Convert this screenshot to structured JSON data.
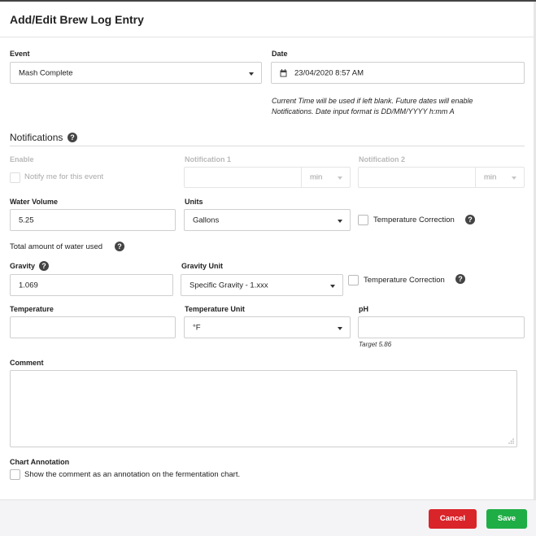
{
  "dialog": {
    "title": "Add/Edit Brew Log Entry"
  },
  "event": {
    "label": "Event",
    "value": "Mash Complete"
  },
  "date": {
    "label": "Date",
    "value": "23/04/2020 8:57 AM",
    "icon": "calendar-icon",
    "note": "Current Time will be used if left blank. Future dates will enable Notifications. Date input format is DD/MM/YYYY h:mm A"
  },
  "notifications": {
    "title": "Notifications",
    "enable_label": "Enable",
    "notify_label": "Notify me for this event",
    "notification1_label": "Notification 1",
    "notification1_value": "",
    "notification1_unit": "min",
    "notification2_label": "Notification 2",
    "notification2_value": "",
    "notification2_unit": "min"
  },
  "water": {
    "label": "Water Volume",
    "value": "5.25",
    "units_label": "Units",
    "units_value": "Gallons",
    "temp_correction_label": "Temperature Correction",
    "help_text": "Total amount of water used"
  },
  "gravity": {
    "label": "Gravity",
    "value": "1.069",
    "unit_label": "Gravity Unit",
    "unit_value": "Specific Gravity - 1.xxx",
    "temp_correction_label": "Temperature Correction"
  },
  "temperature": {
    "label": "Temperature",
    "value": "",
    "unit_label": "Temperature Unit",
    "unit_value": "°F"
  },
  "ph": {
    "label": "pH",
    "value": "",
    "target": "Target 5.86"
  },
  "comment": {
    "label": "Comment",
    "value": ""
  },
  "annotation": {
    "label": "Chart Annotation",
    "checkbox_label": "Show the comment as an annotation on the fermentation chart."
  },
  "footer": {
    "cancel_label": "Cancel",
    "save_label": "Save"
  },
  "colors": {
    "cancel": "#d9242a",
    "save": "#1fae46",
    "help_icon": "#444444"
  }
}
